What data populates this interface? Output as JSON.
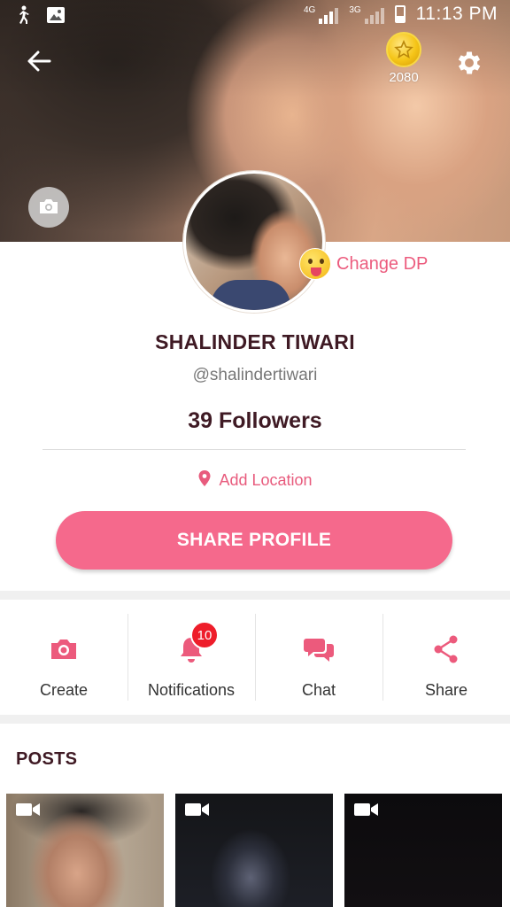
{
  "status_bar": {
    "time": "11:13 PM",
    "network_1": "4G",
    "network_2": "3G",
    "icons": [
      "walk-icon",
      "image-icon",
      "signal-icon",
      "signal-icon",
      "battery-icon"
    ]
  },
  "header": {
    "back_icon": "arrow-left-icon",
    "coins": "2080",
    "coin_icon": "gold-star-coin-icon",
    "settings_icon": "gear-icon",
    "cover_camera_icon": "camera-icon"
  },
  "profile": {
    "change_dp_label": "Change DP",
    "change_dp_icon": "tongue-emoji-icon",
    "name": "SHALINDER TIWARI",
    "handle": "@shalindertiwari",
    "followers": "39 Followers",
    "location_label": "Add Location",
    "location_icon": "map-pin-icon",
    "share_profile_label": "SHARE PROFILE"
  },
  "actions": [
    {
      "label": "Create",
      "icon": "camera-icon"
    },
    {
      "label": "Notifications",
      "icon": "bell-icon",
      "badge": "10"
    },
    {
      "label": "Chat",
      "icon": "chat-bubbles-icon"
    },
    {
      "label": "Share",
      "icon": "share-icon"
    }
  ],
  "posts": {
    "title": "POSTS",
    "items": [
      {
        "type": "video",
        "icon": "video-camera-icon"
      },
      {
        "type": "video",
        "icon": "video-camera-icon"
      },
      {
        "type": "video",
        "icon": "video-camera-icon"
      }
    ]
  },
  "colors": {
    "accent": "#f5698c",
    "accent_text": "#e85b7d",
    "heading": "#3f1a24",
    "badge": "#ee1d2a"
  }
}
